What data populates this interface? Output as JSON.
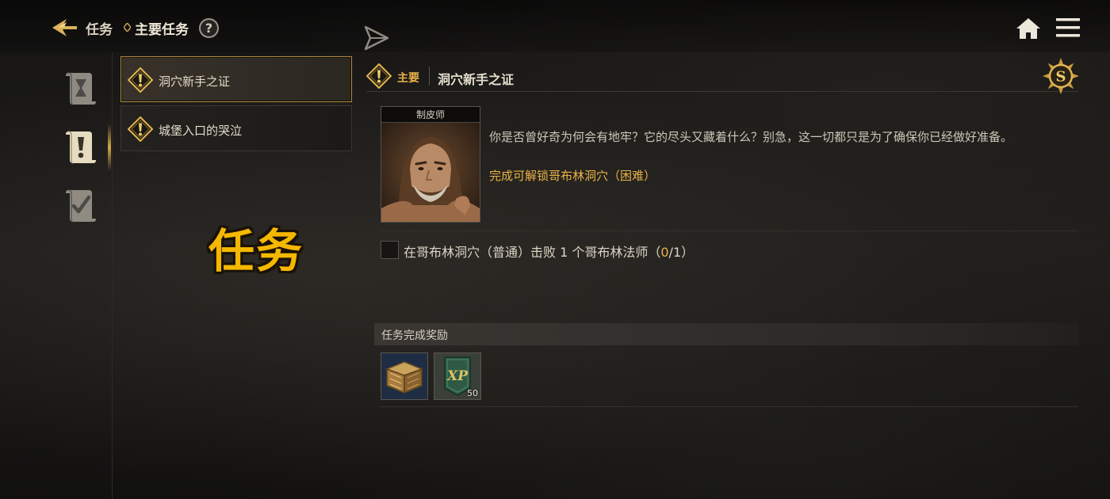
{
  "header": {
    "breadcrumb_root": "任务",
    "breadcrumb_current": "主要任务",
    "help_label": "?"
  },
  "quest_list": [
    {
      "label": "洞穴新手之证",
      "selected": true
    },
    {
      "label": "城堡入口的哭泣",
      "selected": false
    }
  ],
  "watermark": "任务",
  "detail": {
    "type_label": "主要",
    "title": "洞穴新手之证",
    "rank_badge": "S",
    "npc_title": "制皮师",
    "description": "你是否曾好奇为何会有地牢？它的尽头又藏着什么？别急，这一切都只是为了确保你已经做好准备。",
    "unlock_text": "完成可解锁哥布林洞穴（困难）",
    "objective": {
      "text_prefix": "在哥布林洞穴（普通）击败 1 个哥布林法师（",
      "progress_current": "0",
      "text_suffix": "/1）"
    },
    "rewards_title": "任务完成奖励",
    "rewards": [
      {
        "icon": "treasure-chest-icon",
        "count": ""
      },
      {
        "icon": "xp-banner-icon",
        "label": "XP",
        "count": "50"
      }
    ]
  },
  "colors": {
    "accent_gold": "#eab246",
    "selected_border": "#b08a3e",
    "watermark_yellow": "#f5b800"
  }
}
